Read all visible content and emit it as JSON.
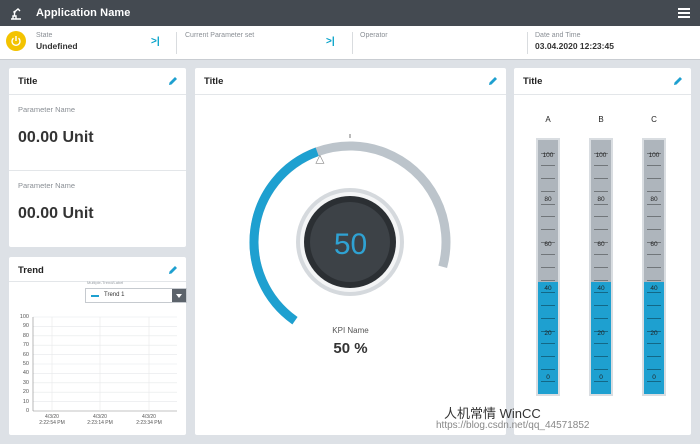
{
  "app": {
    "title": "Application Name",
    "logo_icon": "robot-arm-icon",
    "menu_icon": "hamburger-menu-icon"
  },
  "status": {
    "state_label": "State",
    "state_value": "Undefined",
    "param_label": "Current Parameter set",
    "param_value": "",
    "operator_label": "Operator",
    "operator_value": "",
    "datetime_label": "Date and Time",
    "datetime_value": "03.04.2020 12:23:45",
    "power_color": "#f3c300",
    "jump_icon": "jump-to-icon"
  },
  "card_params": {
    "title": "Title",
    "items": [
      {
        "name": "Parameter Name",
        "value": "00.00 Unit"
      },
      {
        "name": "Parameter Name",
        "value": "00.00 Unit"
      }
    ]
  },
  "card_trend": {
    "title": "Trend",
    "selector_label": "Multiple-Trend/Label",
    "selected_trend": "Trend 1",
    "y_ticks": [
      "100",
      "90",
      "80",
      "70",
      "60",
      "50",
      "40",
      "30",
      "20",
      "10",
      "0"
    ],
    "x_ticks": [
      {
        "date": "4/3/20",
        "time": "2:22:54 PM"
      },
      {
        "date": "4/3/20",
        "time": "2:23:14 PM"
      },
      {
        "date": "4/3/20",
        "time": "2:23:34 PM"
      }
    ]
  },
  "card_gauge": {
    "title": "Title",
    "value_text": "50",
    "value": 50,
    "setpoint_percent": 50,
    "kpi_name": "KPI Name",
    "kpi_value": "50 %",
    "accent": "#1ea0d0"
  },
  "card_bars": {
    "title": "Title",
    "scale": [
      "100",
      "80",
      "60",
      "40",
      "20",
      "0"
    ],
    "bars": [
      {
        "label": "A",
        "value": 44
      },
      {
        "label": "B",
        "value": 44
      },
      {
        "label": "C",
        "value": 44
      }
    ]
  },
  "watermark": {
    "text": "人机常情 WinCC",
    "url": "https://blog.csdn.net/qq_44571852"
  }
}
